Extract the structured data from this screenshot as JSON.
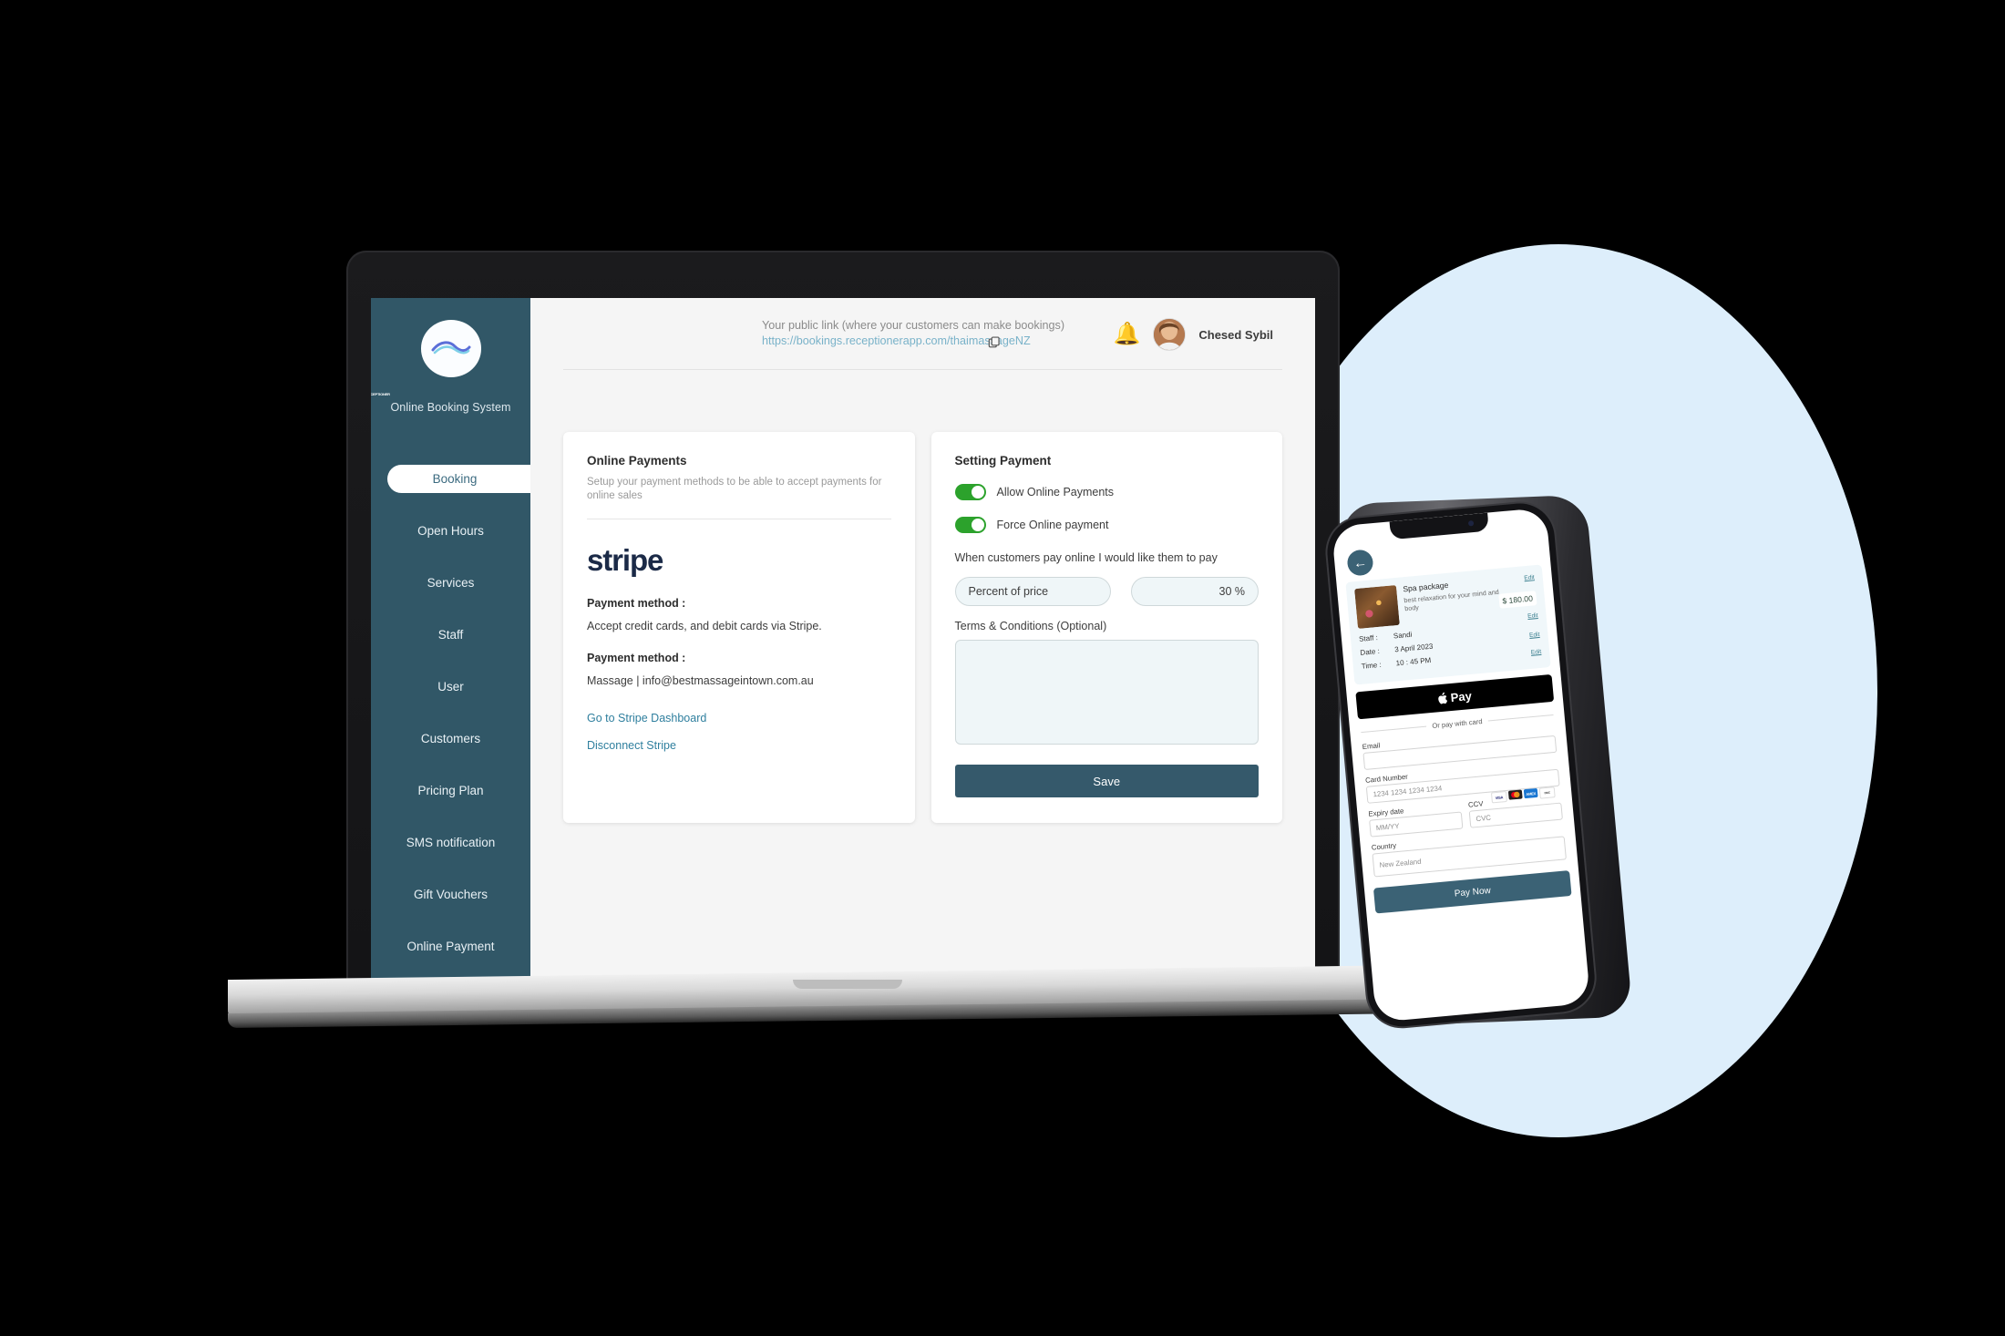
{
  "sidebar": {
    "brand": "RECEPTIONER",
    "brand_sub": "Online Booking System",
    "logo_icon": "wave-logo-icon",
    "items": [
      {
        "label": "Booking",
        "active": true
      },
      {
        "label": "Open Hours",
        "active": false
      },
      {
        "label": "Services",
        "active": false
      },
      {
        "label": "Staff",
        "active": false
      },
      {
        "label": "User",
        "active": false
      },
      {
        "label": "Customers",
        "active": false
      },
      {
        "label": "Pricing Plan",
        "active": false
      },
      {
        "label": "SMS notification",
        "active": false
      },
      {
        "label": "Gift Vouchers",
        "active": false
      },
      {
        "label": "Online Payment",
        "active": false
      }
    ]
  },
  "topbar": {
    "public_link_label": "Your public link (where your customers can make bookings)",
    "public_link_url": "https://bookings.receptionerapp.com/thaimassageNZ",
    "copy_icon": "copy-icon",
    "bell_icon": "bell-icon",
    "user_name": "Chesed Sybil"
  },
  "left_card": {
    "title": "Online Payments",
    "description": "Setup your payment methods to be able to accept payments for online sales",
    "provider_logo": "stripe",
    "payment_method_label_1": "Payment method :",
    "payment_method_value_1": "Accept credit cards, and debit cards via Stripe.",
    "payment_method_label_2": "Payment method :",
    "payment_method_value_2": "Massage | info@bestmassageintown.com.au",
    "dashboard_link": "Go to Stripe Dashboard",
    "disconnect_link": "Disconnect Stripe"
  },
  "right_card": {
    "title": "Setting Payment",
    "toggles": [
      {
        "label": "Allow Online Payments",
        "on": true
      },
      {
        "label": "Force Online payment",
        "on": true
      }
    ],
    "hint": "When customers pay online I would like them to pay",
    "pay_type_value": "Percent of price",
    "pay_amount_value": "30 %",
    "terms_label": "Terms & Conditions (Optional)",
    "terms_value": "",
    "save_label": "Save"
  },
  "phone": {
    "back_icon": "back-arrow-icon",
    "booking": {
      "service_name": "Spa package",
      "service_desc": "best relaxation for your mind and body",
      "price": "$ 180.00",
      "staff_label": "Staff :",
      "staff_value": "Sandi",
      "date_label": "Date :",
      "date_value": "3  April  2023",
      "time_label": "Time :",
      "time_value": "10 : 45 PM",
      "edit_label": "Edit"
    },
    "apple_pay_label": "Pay",
    "or_pay_label": "Or pay with card",
    "email_label": "Email",
    "email_value": "",
    "card_number_label": "Card Number",
    "card_number_placeholder": "1234  1234  1234  1234",
    "card_brands": [
      "VISA",
      "MC",
      "AMEX",
      "DISCOVER"
    ],
    "expiry_label": "Expiry date",
    "expiry_placeholder": "MM/YY",
    "ccv_label": "CCV",
    "ccv_placeholder": "CVC",
    "country_label": "Country",
    "country_value": "New Zealand",
    "pay_now_label": "Pay Now"
  },
  "colors": {
    "sidebar_bg": "#315767",
    "accent": "#3b6275",
    "toggle_on": "#2ca22c",
    "link": "#2f7f9e",
    "bg_circle": "#ddeefb",
    "page_bg": "#000000"
  }
}
